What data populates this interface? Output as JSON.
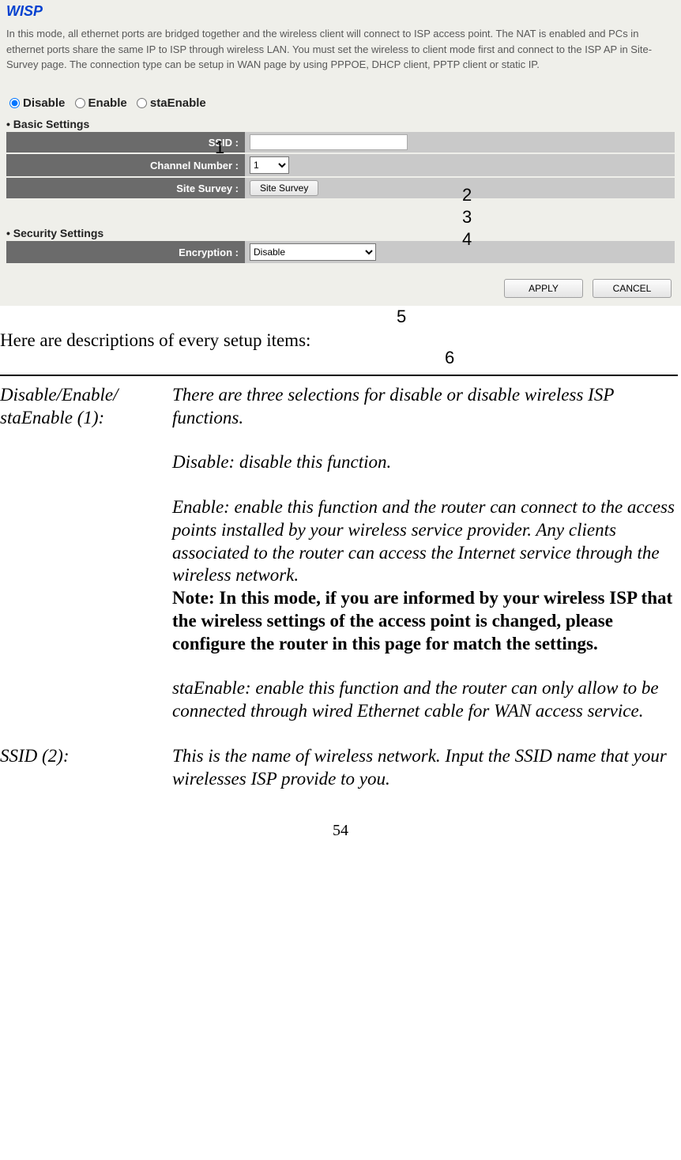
{
  "screenshot": {
    "title": "WISP",
    "description": "In this mode, all ethernet ports are bridged together and the wireless client will connect to ISP access point. The NAT is enabled and PCs in ethernet ports share the same IP to ISP through wireless LAN. You must set the wireless to client mode first and connect to the ISP AP in Site-Survey page. The connection type can be setup in WAN page by using PPPOE, DHCP client, PPTP client or static IP.",
    "radios": {
      "disable": "Disable",
      "enable": "Enable",
      "staEnable": "staEnable"
    },
    "basic_head": "Basic Settings",
    "ssid_label": "SSID :",
    "ssid_value": "",
    "channel_label": "Channel Number :",
    "channel_value": "1",
    "survey_label": "Site Survey :",
    "survey_button": "Site Survey",
    "security_head": "Security Settings",
    "encryption_label": "Encryption :",
    "encryption_value": "Disable",
    "apply": "APPLY",
    "cancel": "CANCEL",
    "annot1": "1",
    "annot2": "2",
    "annot3": "3",
    "annot4": "4",
    "annot5": "5",
    "annot6": "6"
  },
  "doc": {
    "intro": "Here are descriptions of every setup items:",
    "row1_label": "Disable/Enable/ staEnable (1):",
    "row1_p1": "There are three selections for disable or disable wireless ISP functions.",
    "row1_p2": "Disable: disable this function.",
    "row1_p3": "Enable: enable this function and the router can connect to the access points installed by your wireless service provider. Any clients associated to the router can access the Internet service through the wireless network.",
    "row1_note": "Note: In this mode, if you are informed by your wireless ISP that the wireless settings of the access point is changed, please configure the router in this page for match the settings.",
    "row1_p4": "staEnable: enable this function and the router can only allow to be connected through wired Ethernet cable for WAN access service.",
    "row2_label": "SSID (2):",
    "row2_body": "This is the name of wireless network. Input the SSID name that your wirelesses ISP provide to you.",
    "page": "54"
  }
}
